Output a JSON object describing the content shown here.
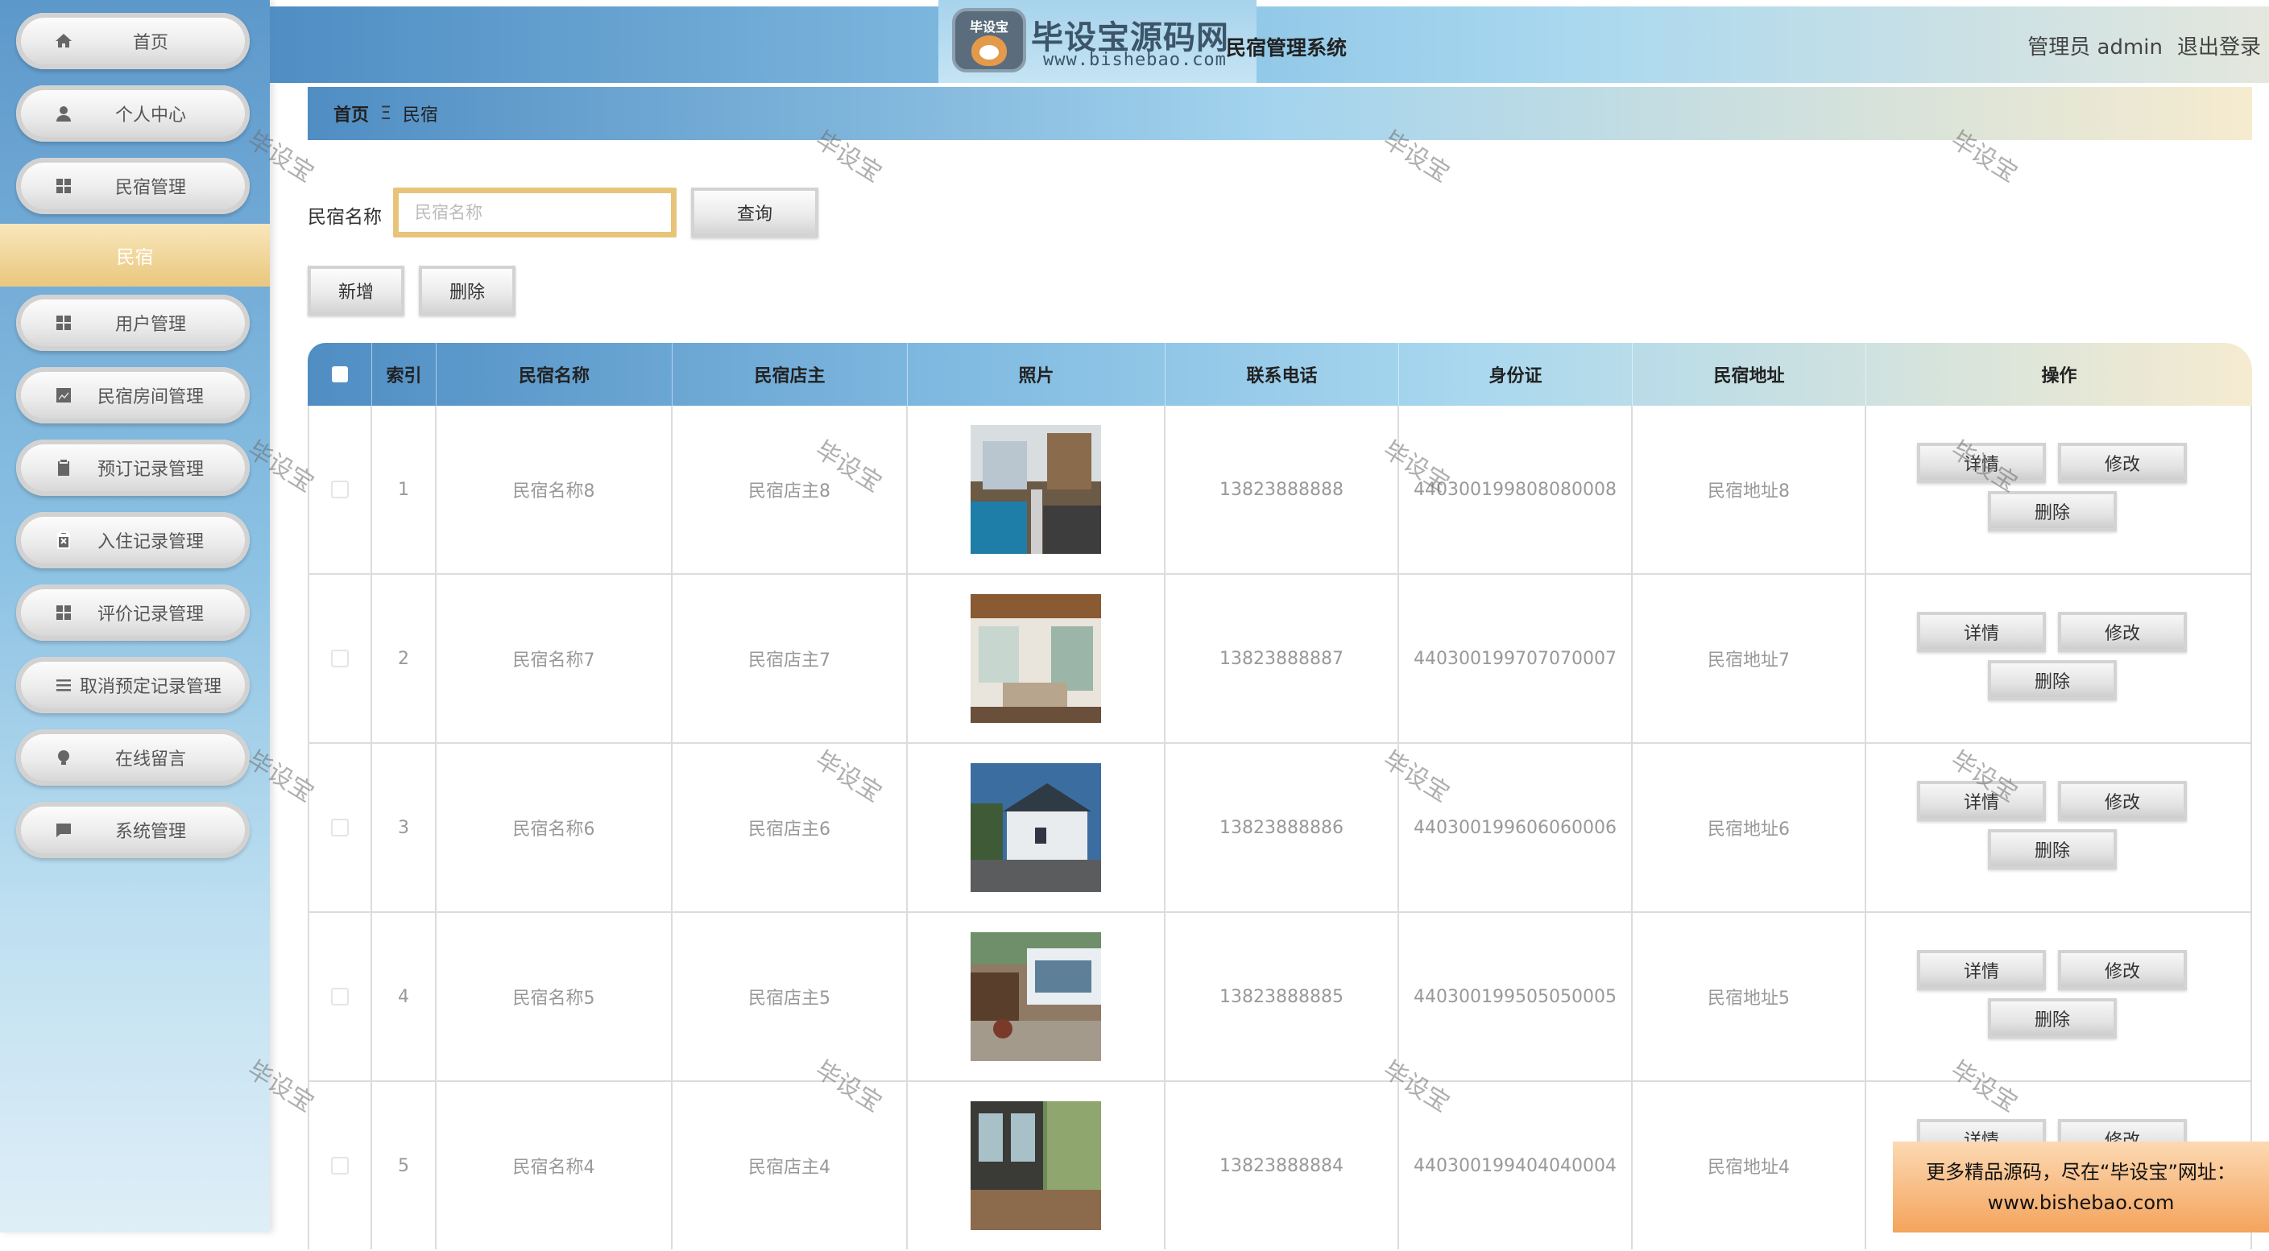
{
  "app": {
    "logo_badge": "毕设宝",
    "logo_title": "毕设宝源码网",
    "logo_url": "www.bishebao.com",
    "system_title": "民宿管理系统",
    "user_label": "管理员 admin",
    "logout_label": "退出登录"
  },
  "sidebar": {
    "items": [
      {
        "label": "首页",
        "icon": "home-icon"
      },
      {
        "label": "个人中心",
        "icon": "user-icon"
      },
      {
        "label": "民宿管理",
        "icon": "grid-icon"
      },
      {
        "label": "民宿",
        "active": true
      },
      {
        "label": "用户管理",
        "icon": "grid-icon"
      },
      {
        "label": "民宿房间管理",
        "icon": "chart-icon"
      },
      {
        "label": "预订记录管理",
        "icon": "clipboard-icon"
      },
      {
        "label": "入住记录管理",
        "icon": "clipboard-x-icon"
      },
      {
        "label": "评价记录管理",
        "icon": "grid-icon"
      },
      {
        "label": "取消预定记录管理",
        "icon": "list-icon"
      },
      {
        "label": "在线留言",
        "icon": "bulb-icon"
      },
      {
        "label": "系统管理",
        "icon": "chat-icon"
      }
    ]
  },
  "breadcrumb": {
    "home": "首页",
    "separator": "Ξ",
    "current": "民宿"
  },
  "search": {
    "label": "民宿名称",
    "placeholder": "民宿名称",
    "value": "",
    "button": "查询"
  },
  "actions": {
    "add": "新增",
    "delete": "删除"
  },
  "table": {
    "headers": [
      "索引",
      "民宿名称",
      "民宿店主",
      "照片",
      "联系电话",
      "身份证",
      "民宿地址",
      "操作"
    ],
    "rows": [
      {
        "index": "1",
        "name": "民宿名称8",
        "owner": "民宿店主8",
        "phone": "13823888888",
        "id_card": "440300199808080008",
        "address": "民宿地址8"
      },
      {
        "index": "2",
        "name": "民宿名称7",
        "owner": "民宿店主7",
        "phone": "13823888887",
        "id_card": "440300199707070007",
        "address": "民宿地址7"
      },
      {
        "index": "3",
        "name": "民宿名称6",
        "owner": "民宿店主6",
        "phone": "13823888886",
        "id_card": "440300199606060006",
        "address": "民宿地址6"
      },
      {
        "index": "4",
        "name": "民宿名称5",
        "owner": "民宿店主5",
        "phone": "13823888885",
        "id_card": "440300199505050005",
        "address": "民宿地址5"
      },
      {
        "index": "5",
        "name": "民宿名称4",
        "owner": "民宿店主4",
        "phone": "13823888884",
        "id_card": "440300199404040004",
        "address": "民宿地址4"
      }
    ],
    "row_actions": {
      "detail": "详情",
      "edit": "修改",
      "delete": "删除"
    }
  },
  "watermark": "毕设宝",
  "promo": {
    "line1": "更多精品源码，尽在“毕设宝”网址：",
    "line2": "www.bishebao.com"
  },
  "colors": {
    "accent_gold": "#e7c47a",
    "header_blue": "#4f8dc3",
    "header_light": "#a9d8ef",
    "promo_orange": "#f4a45c"
  }
}
